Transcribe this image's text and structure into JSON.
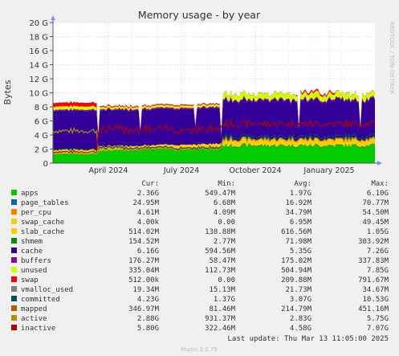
{
  "chart_data": {
    "type": "area",
    "title": "Memory usage - by year",
    "ylabel": "Bytes",
    "side_label": "RRDTOOL / TOBI OETIKER",
    "yticks": [
      "0",
      "2 G",
      "4 G",
      "6 G",
      "8 G",
      "10 G",
      "12 G",
      "14 G",
      "16 G",
      "18 G",
      "20 G"
    ],
    "ylim": [
      0,
      20
    ],
    "xticks": [
      "April 2024",
      "July 2024",
      "October 2024",
      "January 2025"
    ],
    "grid": true,
    "legend_headers": {
      "cur": "Cur:",
      "min": "Min:",
      "avg": "Avg:",
      "max": "Max:"
    },
    "legend": [
      {
        "name": "apps",
        "color": "#00cc00",
        "cur": "2.36G",
        "min": "549.47M",
        "avg": "1.97G",
        "max": "6.10G"
      },
      {
        "name": "page_tables",
        "color": "#0066b3",
        "cur": "24.95M",
        "min": "6.68M",
        "avg": "16.92M",
        "max": "70.77M"
      },
      {
        "name": "per_cpu",
        "color": "#ff8000",
        "cur": "4.61M",
        "min": "4.09M",
        "avg": "34.79M",
        "max": "54.50M"
      },
      {
        "name": "swap_cache",
        "color": "#ffcc00",
        "cur": "4.00k",
        "min": "0.00",
        "avg": "6.95M",
        "max": "49.45M"
      },
      {
        "name": "slab_cache",
        "color": "#ffcc00",
        "cur": "514.02M",
        "min": "138.88M",
        "avg": "616.56M",
        "max": "1.05G"
      },
      {
        "name": "shmem",
        "color": "#008f00",
        "cur": "154.52M",
        "min": "2.77M",
        "avg": "71.98M",
        "max": "303.92M"
      },
      {
        "name": "cache",
        "color": "#330099",
        "cur": "6.16G",
        "min": "594.56M",
        "avg": "5.35G",
        "max": "7.26G"
      },
      {
        "name": "buffers",
        "color": "#990099",
        "cur": "176.27M",
        "min": "58.47M",
        "avg": "175.02M",
        "max": "337.83M"
      },
      {
        "name": "unused",
        "color": "#ccff00",
        "cur": "335.04M",
        "min": "112.73M",
        "avg": "504.94M",
        "max": "7.85G"
      },
      {
        "name": "swap",
        "color": "#ff0000",
        "cur": "512.00k",
        "min": "0.00",
        "avg": "209.88M",
        "max": "791.67M"
      },
      {
        "name": "vmalloc_used",
        "color": "#808080",
        "cur": "19.34M",
        "min": "15.13M",
        "avg": "21.73M",
        "max": "34.67M"
      },
      {
        "name": "committed",
        "color": "#00505a",
        "cur": "4.23G",
        "min": "1.37G",
        "avg": "3.07G",
        "max": "10.53G"
      },
      {
        "name": "mapped",
        "color": "#b35900",
        "cur": "346.97M",
        "min": "81.46M",
        "avg": "214.79M",
        "max": "451.16M"
      },
      {
        "name": "active",
        "color": "#b38f00",
        "cur": "2.88G",
        "min": "931.37M",
        "avg": "2.83G",
        "max": "5.75G"
      },
      {
        "name": "inactive",
        "color": "#b30000",
        "cur": "5.80G",
        "min": "322.46M",
        "avg": "4.58G",
        "max": "7.07G"
      }
    ],
    "last_update": "Last update: Thu Mar 13 11:05:00 2025",
    "footer": "Munin 2.0.75"
  }
}
